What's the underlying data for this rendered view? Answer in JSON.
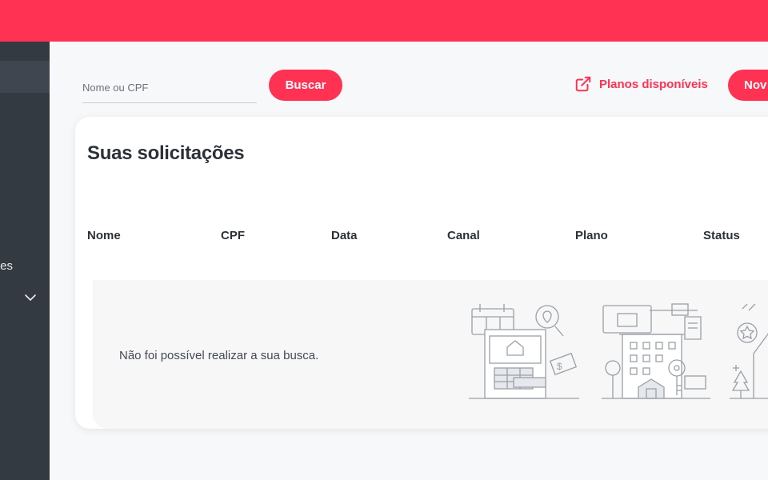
{
  "sidebar": {
    "items": [
      {
        "label": "tes",
        "icon": "chevron-down-icon"
      }
    ]
  },
  "search": {
    "placeholder": "Nome ou CPF",
    "button_label": "Buscar"
  },
  "header": {
    "planos_label": "Planos disponíveis",
    "planos_icon": "external-link-icon",
    "novo_label": "Nov"
  },
  "card": {
    "title": "Suas solicitações",
    "columns": [
      "Nome",
      "CPF",
      "Data",
      "Canal",
      "Plano",
      "Status"
    ],
    "empty_message": "Não foi possível realizar a sua busca."
  },
  "colors": {
    "brand": "#ff3254",
    "sidebar": "#343a42",
    "background": "#f7f8fa"
  }
}
